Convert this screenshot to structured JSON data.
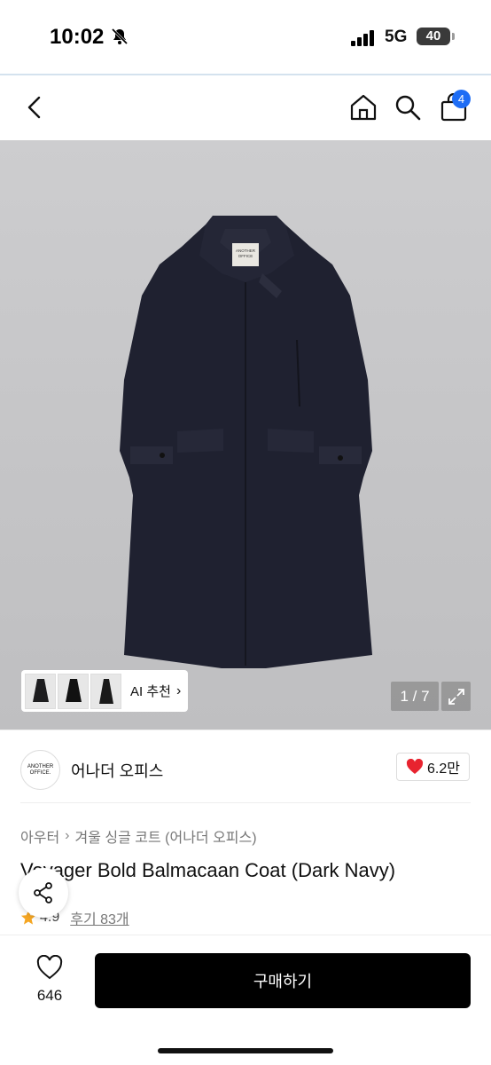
{
  "status": {
    "time": "10:02",
    "network": "5G",
    "battery": "40"
  },
  "nav": {
    "cart_count": "4",
    "icons": [
      "back-icon",
      "home-icon",
      "search-icon",
      "cart-icon"
    ]
  },
  "gallery": {
    "brand_tag_line1": "ANOTHER",
    "brand_tag_line2": "OFFICE",
    "ai_label": "AI 추천",
    "ai_chevron": "›",
    "pager": "1 / 7"
  },
  "brand": {
    "logo_line1": "ANOTHER",
    "logo_line2": "OFFICE.",
    "name": "어나더 오피스",
    "likes": "6.2만"
  },
  "breadcrumb": {
    "category": "아우터",
    "separator": "›",
    "subcategory": "겨울 싱글 코트 (어나더 오피스)"
  },
  "product": {
    "title": "Voyager Bold Balmacaan Coat (Dark Navy)",
    "rating": "4.9",
    "reviews": "후기 83개"
  },
  "bottom": {
    "wish_count": "646",
    "buy_label": "구매하기"
  },
  "colors": {
    "accent": "#1e6df5",
    "heart": "#e8232f",
    "star": "#f5a623",
    "coat": "#1f2130"
  }
}
